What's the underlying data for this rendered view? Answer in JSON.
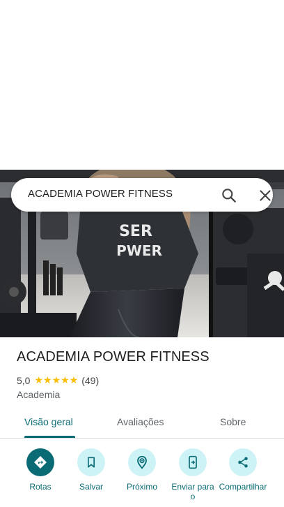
{
  "search": {
    "query": "ACADEMIA POWER FITNESS"
  },
  "photo": {
    "shirt_text_line1": "SER",
    "shirt_text_line2": "PWER"
  },
  "place": {
    "title": "ACADEMIA POWER FITNESS",
    "rating": "5,0",
    "stars": "★★★★★",
    "review_count": "(49)",
    "category": "Academia"
  },
  "tabs": [
    {
      "label": "Visão geral",
      "active": true
    },
    {
      "label": "Avaliações",
      "active": false
    },
    {
      "label": "Sobre",
      "active": false
    }
  ],
  "actions": [
    {
      "label": "Rotas",
      "icon": "directions-icon"
    },
    {
      "label": "Salvar",
      "icon": "bookmark-icon"
    },
    {
      "label": "Próximo",
      "icon": "nearby-icon"
    },
    {
      "label": "Enviar para o",
      "icon": "send-to-phone-icon"
    },
    {
      "label": "Compartilhar",
      "icon": "share-icon"
    }
  ],
  "colors": {
    "accent": "#0b6b74",
    "action_bg": "#cdf3f7",
    "star": "#fbbc04"
  }
}
